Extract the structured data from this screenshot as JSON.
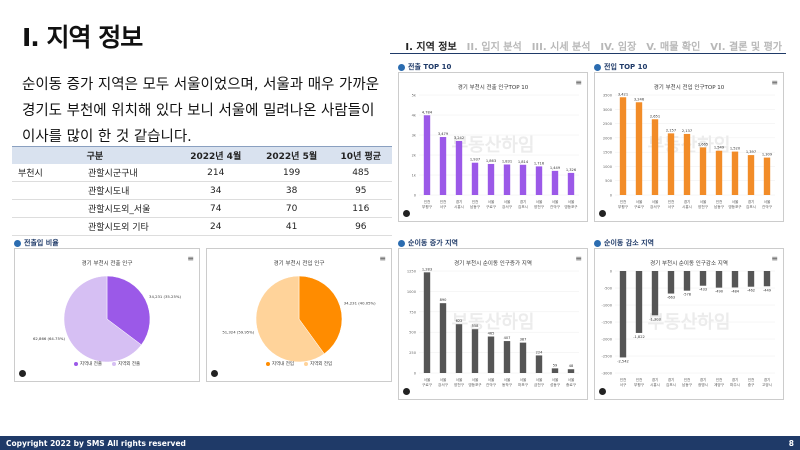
{
  "title": "I. 지역 정보",
  "nav": [
    {
      "label": "I. 지역 정보",
      "active": true
    },
    {
      "label": "II. 입지 분석",
      "active": false
    },
    {
      "label": "III. 시세 분석",
      "active": false
    },
    {
      "label": "IV. 임장",
      "active": false
    },
    {
      "label": "V. 매물 확인",
      "active": false
    },
    {
      "label": "VI. 결론 및 평가",
      "active": false
    }
  ],
  "paragraph": "순이동 증가 지역은 모두 서울이었으며, 서울과 매우 가까운 경기도 부천에 위치해 있다 보니 서울에 밀려나온 사람들이 이사를 많이 한 것 같습니다.",
  "table": {
    "headers": [
      "구분",
      "2022년 4월",
      "2022년 5월",
      "10년 평균"
    ],
    "rows": [
      {
        "group": "부천시",
        "name": "관할시군구내",
        "v": [
          "214",
          "199",
          "485"
        ]
      },
      {
        "group": "",
        "name": "관할시도내",
        "v": [
          "34",
          "38",
          "95"
        ]
      },
      {
        "group": "",
        "name": "관할시도외_서울",
        "v": [
          "74",
          "70",
          "116"
        ]
      },
      {
        "group": "",
        "name": "관할시도외 기타",
        "v": [
          "24",
          "41",
          "96"
        ]
      }
    ]
  },
  "sections": {
    "out_top10": "전출 TOP 10",
    "in_top10": "전입 TOP 10",
    "in_out_ratio": "전출입 비율",
    "net_increase": "순이동 증가 지역",
    "net_decrease": "순이동 감소 지역"
  },
  "watermark": "부동산하임",
  "charts": {
    "out_bar": {
      "title": "경기 부천시 전출 인구TOP 10",
      "color": "#9b59e8"
    },
    "in_bar": {
      "title": "경기 부천시 전입 인구TOP 10",
      "color": "#f28c28"
    },
    "out_pie": {
      "title": "경기 부천시 전출 인구",
      "legend": [
        "지역내 전출",
        "지역외 전출"
      ],
      "colors": [
        "#9b59e8",
        "#d6bff3"
      ]
    },
    "in_pie": {
      "title": "경기 부천시 전입 인구",
      "legend": [
        "지역내 전입",
        "지역외 전입"
      ],
      "colors": [
        "#ff8c00",
        "#ffd39a"
      ]
    },
    "net_inc": {
      "title": "경기 부천시 순이동 인구증가 지역",
      "color": "#555555"
    },
    "net_dec": {
      "title": "경기 부천시 순이동 인구감소 지역",
      "color": "#555555"
    }
  },
  "chart_data": [
    {
      "type": "bar",
      "id": "out_bar",
      "title": "경기 부천시 전출 인구TOP 10",
      "categories": [
        "인천 부평구",
        "인천 서구",
        "경기 시흥시",
        "인천 남동구",
        "서울 구로구",
        "서울 강서구",
        "경기 김포시",
        "서울 양천구",
        "서울 관악구",
        "서울 영등포구"
      ],
      "values": [
        4784,
        3479,
        3242,
        1937,
        1863,
        1831,
        1814,
        1716,
        1449,
        1326
      ],
      "ylim": [
        0,
        6000
      ],
      "yticks": [
        "0",
        "1k",
        "2k",
        "3k",
        "4k",
        "5k"
      ]
    },
    {
      "type": "bar",
      "id": "in_bar",
      "title": "경기 부천시 전입 인구TOP 10",
      "categories": [
        "인천 부평구",
        "서울 구로구",
        "서울 강서구",
        "인천 서구",
        "경기 시흥시",
        "서울 양천구",
        "인천 남동구",
        "서울 영등포구",
        "경기 김포시",
        "서울 관악구"
      ],
      "values": [
        3421,
        3246,
        2651,
        2157,
        2137,
        1665,
        1549,
        1520,
        1397,
        1309
      ],
      "ylim": [
        0,
        3500
      ],
      "yticks": [
        "0",
        "500",
        "1000",
        "1500",
        "2000",
        "2500",
        "3000",
        "3500"
      ]
    },
    {
      "type": "pie",
      "id": "out_pie",
      "title": "경기 부천시 전출 인구",
      "slices": [
        {
          "label": "지역내 전출",
          "value": 34231,
          "text": "34,231 (35.25%)"
        },
        {
          "label": "지역외 전출",
          "value": 62866,
          "text": "62,866 (64.75%)"
        }
      ]
    },
    {
      "type": "pie",
      "id": "in_pie",
      "title": "경기 부천시 전입 인구",
      "slices": [
        {
          "label": "지역내 전입",
          "value": 34231,
          "text": "34,231 (40.05%)"
        },
        {
          "label": "지역외 전입",
          "value": 51324,
          "text": "51,324 (59.95%)"
        }
      ]
    },
    {
      "type": "bar",
      "id": "net_inc",
      "title": "경기 부천시 순이동 인구증가 지역",
      "categories": [
        "서울 구로구",
        "서울 강서구",
        "서울 양천구",
        "서울 영등포구",
        "서울 관악구",
        "서울 동작구",
        "서울 마포구",
        "서울 금천구",
        "서울 성동구",
        "서울 종로구"
      ],
      "values": [
        1283,
        890,
        622,
        558,
        465,
        407,
        387,
        224,
        59,
        48
      ],
      "ylim": [
        0,
        1300
      ],
      "yticks": [
        "0",
        "250",
        "500",
        "750",
        "1000",
        "1250"
      ]
    },
    {
      "type": "bar",
      "id": "net_dec",
      "title": "경기 부천시 순이동 인구감소 지역",
      "categories": [
        "인천 서구",
        "인천 부평구",
        "경기 시흥시",
        "경기 김포시",
        "인천 남동구",
        "경기 광명시",
        "인천 계양구",
        "경기 파주시",
        "인천 중구",
        "경기 고양시"
      ],
      "values": [
        -2542,
        -1822,
        -1303,
        -663,
        -578,
        -433,
        -490,
        -484,
        -462,
        -449
      ],
      "ylim": [
        -3000,
        0
      ],
      "yticks": [
        "-3000",
        "-2500",
        "-2000",
        "-1500",
        "-1000",
        "-500",
        "0"
      ]
    }
  ],
  "footer": {
    "copyright": "Copyright 2022 by SMS  All rights reserved",
    "page": "8"
  }
}
